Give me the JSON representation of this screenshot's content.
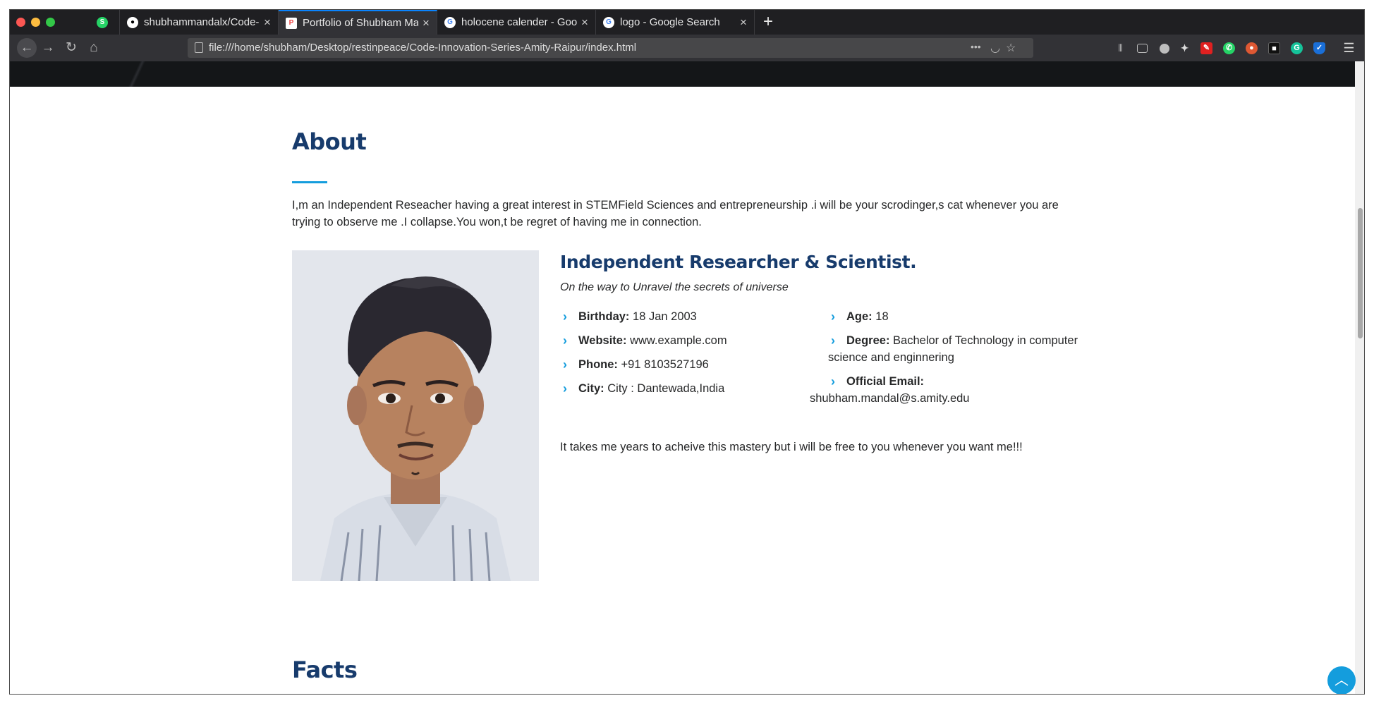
{
  "browser": {
    "tabs": [
      {
        "title": "",
        "favicon": "whatsapp-badge-icon"
      },
      {
        "title": "shubhammandalx/Code-I",
        "favicon": "github-icon"
      },
      {
        "title": "Portfolio of Shubham Ma",
        "favicon": "portfolio-icon"
      },
      {
        "title": "holocene calender - Goo",
        "favicon": "google-icon"
      },
      {
        "title": "logo - Google Search",
        "favicon": "google-icon"
      }
    ],
    "url": "file:///home/shubham/Desktop/restinpeace/Code-Innovation-Series-Amity-Raipur/index.html",
    "url_actions": "•••"
  },
  "about": {
    "title": "About",
    "description": "I,m an Independent Reseacher having a great interest in STEMField Sciences and entrepreneurship .i will be your scrodinger,s cat whenever you are trying to observe me .I collapse.You won,t be regret of having me in connection.",
    "profile_title": "Independent Researcher & Scientist.",
    "profile_subtitle": "On the way to Unravel the secrets of universe",
    "left_info": [
      {
        "label": "Birthday:",
        "value": "18 Jan 2003"
      },
      {
        "label": "Website:",
        "value": "www.example.com"
      },
      {
        "label": "Phone:",
        "value": "+91 8103527196"
      },
      {
        "label": "City:",
        "value": "City : Dantewada,India"
      }
    ],
    "right_info": [
      {
        "label": "Age:",
        "value": "18"
      },
      {
        "label": "Degree:",
        "value": "Bachelor of Technology in computer science and enginnering"
      },
      {
        "label": "Official Email:",
        "value": "shubham.mandal@s.amity.edu"
      }
    ],
    "closing": "It takes me years to acheive this mastery but i will be free to you whenever you want me!!!"
  },
  "facts": {
    "title": "Facts"
  },
  "colors": {
    "accent": "#149ddd",
    "heading": "#173b6c",
    "text": "#272829"
  }
}
